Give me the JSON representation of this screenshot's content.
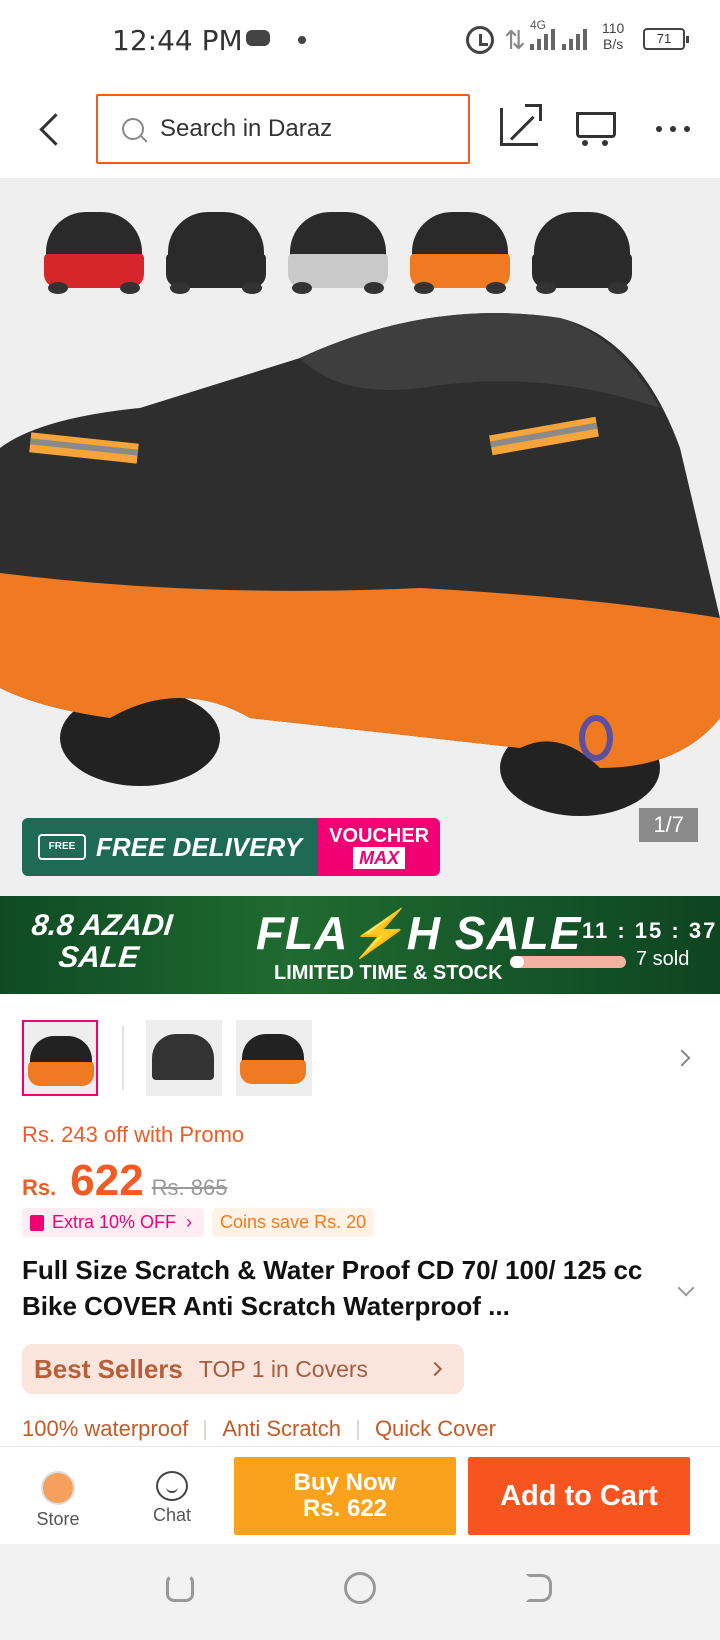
{
  "status_bar": {
    "time": "12:44 PM",
    "network": "4G",
    "speed_value": "110",
    "speed_unit": "B/s",
    "battery": "71"
  },
  "header": {
    "search_placeholder": "Search in Daraz"
  },
  "hero": {
    "variant_colors": [
      "#d6262c",
      "#2b2b2b",
      "#c9c9c9",
      "#f07a22",
      "#2b2b2b"
    ],
    "free_delivery_icon_text": "FREE",
    "free_delivery": "FREE DELIVERY",
    "voucher_top": "VOUCHER",
    "voucher_bottom": "MAX",
    "image_counter": "1/7"
  },
  "flash_sale": {
    "campaign_line1": "8.8 AZADI",
    "campaign_line2": "SALE",
    "title_part1": "FLA",
    "title_bolt": "⚡",
    "title_part2": "H SALE",
    "subtitle": "LIMITED TIME & STOCK",
    "timer": "11 : 15 : 37",
    "sold_progress": 0.12,
    "sold": "7 sold"
  },
  "product": {
    "promo": "Rs. 243 off with Promo",
    "currency": "Rs.",
    "price": "622",
    "original_price": "Rs. 865",
    "extra_off": "Extra 10% OFF",
    "coins_save": "Coins save Rs. 20",
    "title": "Full Size Scratch & Water Proof CD 70/ 100/ 125 cc Bike COVER Anti Scratch Waterproof ...",
    "best_sellers_label": "Best Sellers",
    "best_sellers_rank": "TOP 1 in Covers",
    "features": [
      "100% waterproof",
      "Anti Scratch",
      "Quick Cover"
    ]
  },
  "bottom_bar": {
    "store_label": "Store",
    "chat_label": "Chat",
    "buy_now_line1": "Buy Now",
    "buy_now_line2": "Rs. 622",
    "add_to_cart": "Add to Cart"
  }
}
